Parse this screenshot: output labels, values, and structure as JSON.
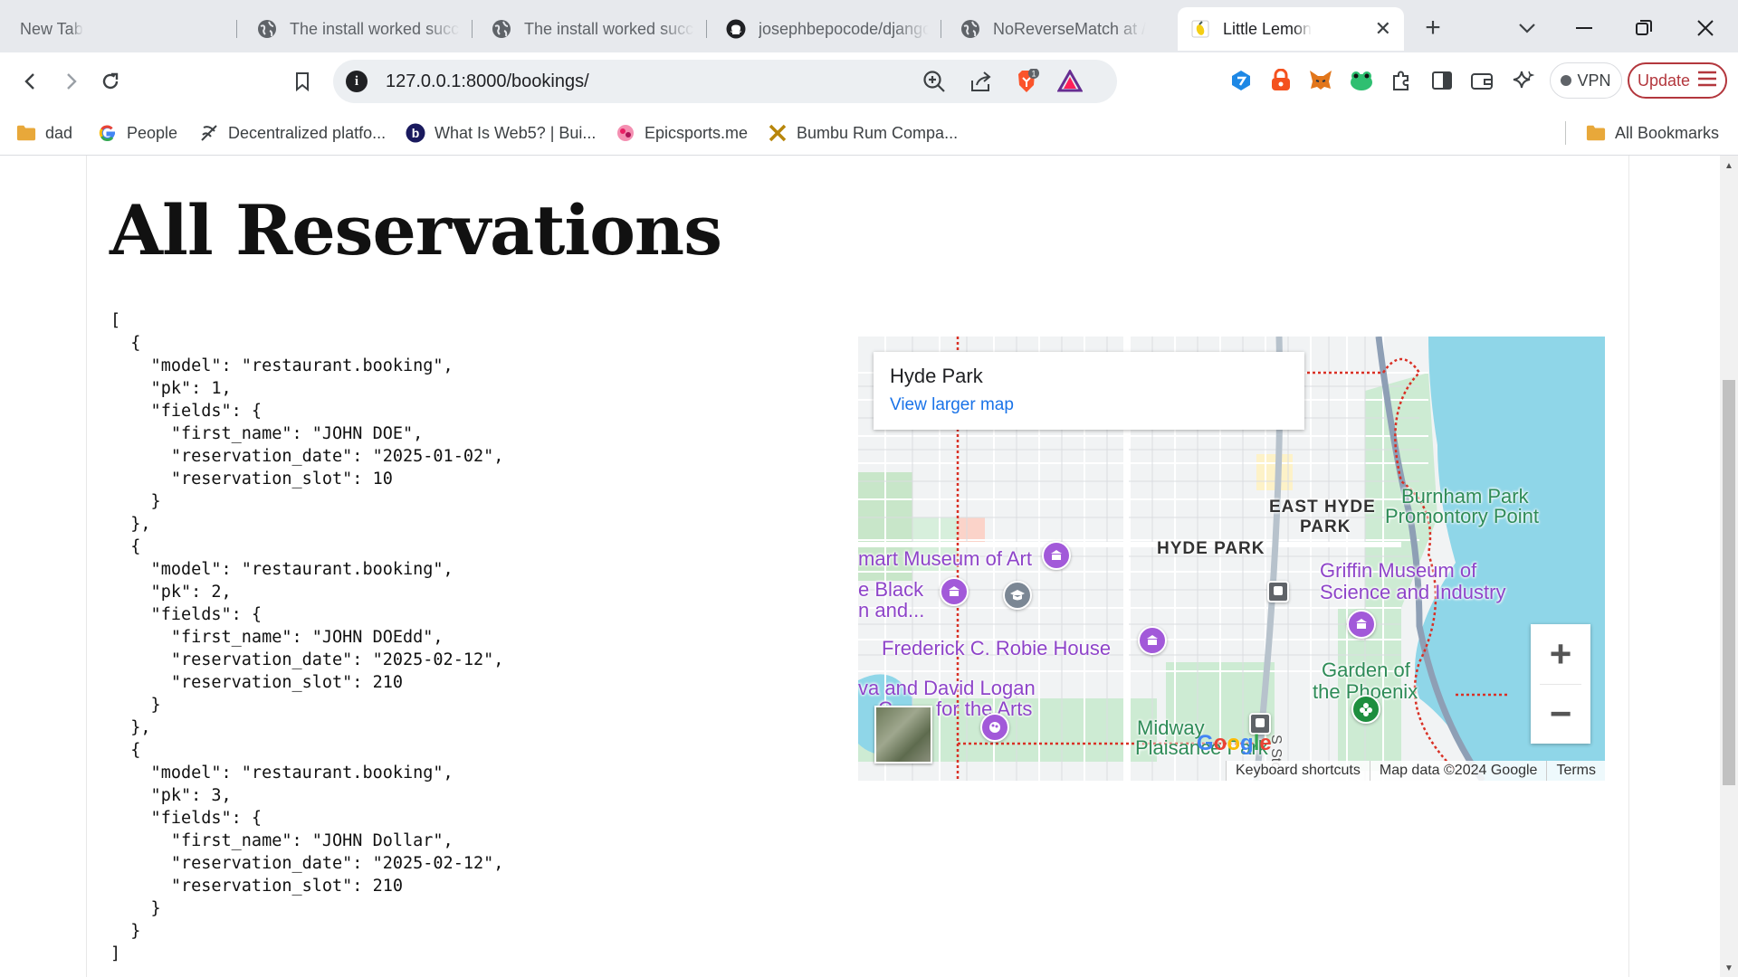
{
  "browser": {
    "tabs": [
      {
        "title": "New Tab",
        "icon": "none"
      },
      {
        "title": "The install worked successfully!",
        "icon": "globe-icon"
      },
      {
        "title": "The install worked successfully!",
        "icon": "globe-icon"
      },
      {
        "title": "josephbepocode/django",
        "icon": "github-icon"
      },
      {
        "title": "NoReverseMatch at /",
        "icon": "globe-icon"
      },
      {
        "title": "Little Lemon",
        "icon": "lemon-icon"
      }
    ],
    "new_tab_symbol": "+",
    "close_symbol": "✕",
    "url": "127.0.0.1:8000/bookings/",
    "brave_badge": "1",
    "vpn_label": "VPN",
    "update_label": "Update",
    "accent_color": "#b3373d"
  },
  "bookmarks": {
    "items": [
      {
        "label": "dad",
        "icon": "folder-icon"
      },
      {
        "label": "People",
        "icon": "google-icon"
      },
      {
        "label": "Decentralized platfo...",
        "icon": "decentralized-icon"
      },
      {
        "label": "What Is Web5? | Bui...",
        "icon": "b-icon"
      },
      {
        "label": "Epicsports.me",
        "icon": "epicsports-icon"
      },
      {
        "label": "Bumbu Rum Compa...",
        "icon": "bumbu-icon"
      }
    ],
    "all_bookmarks": "All Bookmarks"
  },
  "page": {
    "heading": "All Reservations",
    "json_text": "[\n  {\n    \"model\": \"restaurant.booking\",\n    \"pk\": 1,\n    \"fields\": {\n      \"first_name\": \"JOHN DOE\",\n      \"reservation_date\": \"2025-01-02\",\n      \"reservation_slot\": 10\n    }\n  },\n  {\n    \"model\": \"restaurant.booking\",\n    \"pk\": 2,\n    \"fields\": {\n      \"first_name\": \"JOHN DOEdd\",\n      \"reservation_date\": \"2025-02-12\",\n      \"reservation_slot\": 210\n    }\n  },\n  {\n    \"model\": \"restaurant.booking\",\n    \"pk\": 3,\n    \"fields\": {\n      \"first_name\": \"JOHN Dollar\",\n      \"reservation_date\": \"2025-02-12\",\n      \"reservation_slot\": 210\n    }\n  }\n]"
  },
  "map": {
    "place_name": "Hyde Park",
    "view_larger": "View larger map",
    "labels": {
      "smart_museum": "mart Museum of Art",
      "black": "e Black",
      "black2": "n and...",
      "robie": "Frederick C. Robie House",
      "logan1": "va and David Logan",
      "logan2": "C",
      "logan3": "for the Arts",
      "midway1": "Midway",
      "midway2": "Plaisance Park",
      "hyde_park": "HYDE PARK",
      "east_hyde_1": "EAST HYDE",
      "east_hyde_2": "PARK",
      "burnham1": "Burnham Park",
      "burnham2": "Promontory Point",
      "griffin1": "Griffin Museum of",
      "griffin2": "Science and Industry",
      "garden1": "Garden of",
      "garden2": "the Phoenix",
      "street": "S Sto"
    },
    "zoom_in": "+",
    "zoom_out": "−",
    "google": "Google",
    "keyboard": "Keyboard shortcuts",
    "map_data": "Map data ©2024 Google",
    "terms": "Terms",
    "colors": {
      "water": "#8fd6e8",
      "park": "#bfe5c8",
      "road": "#ffffff",
      "boundary": "#d93025",
      "poi": "#a259d9"
    }
  }
}
